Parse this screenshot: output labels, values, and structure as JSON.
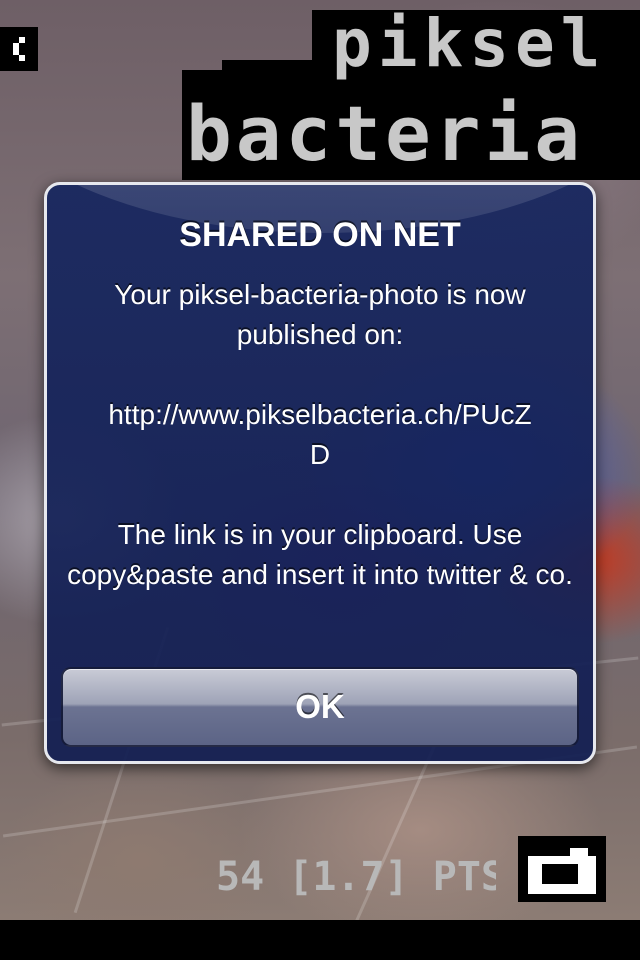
{
  "app": {
    "logo_text": [
      "piksel",
      "bacteria"
    ]
  },
  "alert": {
    "title": "SHARED ON NET",
    "message_lines": [
      "Your piksel-bacteria-photo is now published on:",
      "http://www.pikselbacteria.ch/PUcZ\nD",
      "The link is  in your clipboard. Use copy&paste and insert it into twitter & co."
    ],
    "ok_label": "OK"
  },
  "score": {
    "text": "54 [1.7] PTS"
  },
  "icons": {
    "back": "chevron-left-icon",
    "camera": "camera-icon"
  },
  "colors": {
    "alert_background": "#16265f",
    "alert_border": "#e6e8ee",
    "logo": "#c8c8c8",
    "score": "#b8b8b8"
  }
}
